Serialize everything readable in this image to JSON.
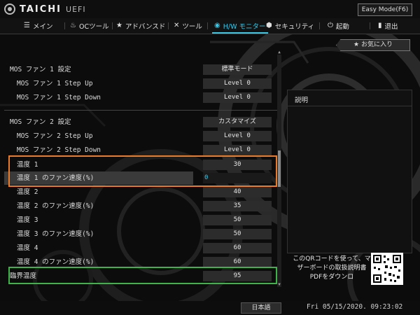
{
  "app": {
    "logo_text": "TAICHI",
    "logo_sub": "UEFI",
    "easy_mode_label": "Easy Mode(F6)"
  },
  "menu": [
    {
      "label": "メイン",
      "icon": "list-icon"
    },
    {
      "label": "OCツール",
      "icon": "flame-icon"
    },
    {
      "label": "アドバンスド",
      "icon": "star-icon"
    },
    {
      "label": "ツール",
      "icon": "wrench-icon"
    },
    {
      "label": "H/W モニター",
      "icon": "monitor-icon",
      "active": true
    },
    {
      "label": "セキュリティ",
      "icon": "shield-icon"
    },
    {
      "label": "起動",
      "icon": "power-icon"
    },
    {
      "label": "退出",
      "icon": "exit-icon"
    }
  ],
  "favorites_label": "お気に入り",
  "settings": [
    {
      "label": "MOS ファン 1 設定",
      "value": "標準モード",
      "sub": false
    },
    {
      "label": "MOS ファン 1 Step Up",
      "value": "Level 0",
      "sub": true
    },
    {
      "label": "MOS ファン 1 Step Down",
      "value": "Level 0",
      "sub": true
    },
    {
      "label": "MOS ファン 2 設定",
      "value": "カスタマイズ",
      "sub": false
    },
    {
      "label": "MOS ファン 2 Step Up",
      "value": "Level 0",
      "sub": true
    },
    {
      "label": "MOS ファン 2 Step Down",
      "value": "Level 0",
      "sub": true
    },
    {
      "label": "温度 1",
      "value": "30",
      "sub": true
    },
    {
      "label": "温度 1 のファン速度(%)",
      "value": "0",
      "sub": true,
      "selected": true
    },
    {
      "label": "温度 2",
      "value": "40",
      "sub": true
    },
    {
      "label": "温度 2 のファン速度(%)",
      "value": "35",
      "sub": true
    },
    {
      "label": "温度 3",
      "value": "50",
      "sub": true
    },
    {
      "label": "温度 3 のファン速度(%)",
      "value": "50",
      "sub": true
    },
    {
      "label": "温度 4",
      "value": "60",
      "sub": true
    },
    {
      "label": "温度 4 のファン速度(%)",
      "value": "60",
      "sub": true
    },
    {
      "label": "臨界温度",
      "value": "95",
      "sub": false
    }
  ],
  "description": {
    "title": "説明"
  },
  "qr_text": "このQRコードを使って、マザーボードの取扱説明書PDFをダウンロ",
  "status": {
    "language": "日本語",
    "datetime": "Fri 05/15/2020. 09:23:02"
  },
  "colors": {
    "accent": "#39c7e6",
    "highlight_orange": "#e97d2c",
    "highlight_green": "#3eb34a"
  }
}
